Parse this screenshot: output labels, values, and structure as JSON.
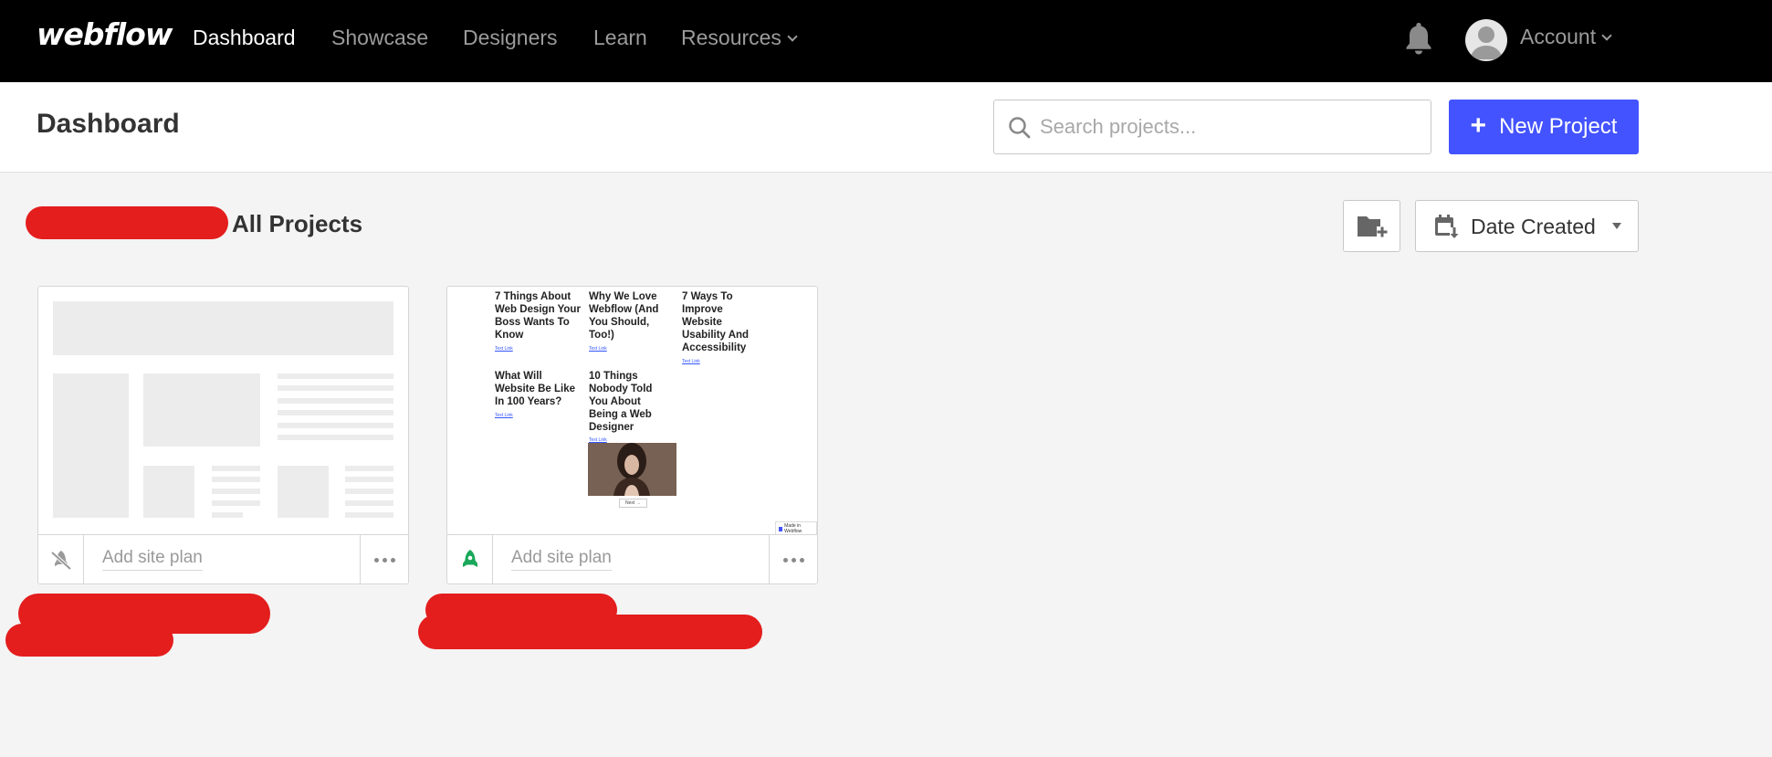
{
  "nav": {
    "logo": "webflow",
    "links": [
      {
        "label": "Dashboard",
        "active": true
      },
      {
        "label": "Showcase"
      },
      {
        "label": "Designers"
      },
      {
        "label": "Learn"
      },
      {
        "label": "Resources"
      }
    ],
    "account_label": "Account"
  },
  "header": {
    "title": "Dashboard",
    "search_placeholder": "Search projects...",
    "new_project_label": "New Project"
  },
  "toolbar": {
    "section_title": "All Projects",
    "sort_label": "Date Created"
  },
  "projects": [
    {
      "site_plan_label": "Add site plan",
      "status_icon": "unpublished-icon"
    },
    {
      "site_plan_label": "Add site plan",
      "status_icon": "published-rocket-icon",
      "preview": {
        "posts": [
          {
            "title": "7 Things About Web Design Your Boss Wants To Know",
            "link": "Text Link"
          },
          {
            "title": "Why We Love Webflow (And You Should, Too!)",
            "link": "Text Link"
          },
          {
            "title": "7 Ways To Improve Website Usability And Accessibility",
            "link": "Text Link"
          },
          {
            "title": "What Will Website Be Like In 100 Years?",
            "link": "Text Link"
          },
          {
            "title": "10 Things Nobody Told You About Being a Web Designer",
            "link": "Text Link"
          }
        ],
        "next_label": "Next →",
        "badge_label": "Made in Webflow"
      }
    }
  ],
  "colors": {
    "nav_bg": "#000000",
    "accent": "#4353ff",
    "published": "#1aa85a",
    "redaction": "#e41d1d"
  }
}
